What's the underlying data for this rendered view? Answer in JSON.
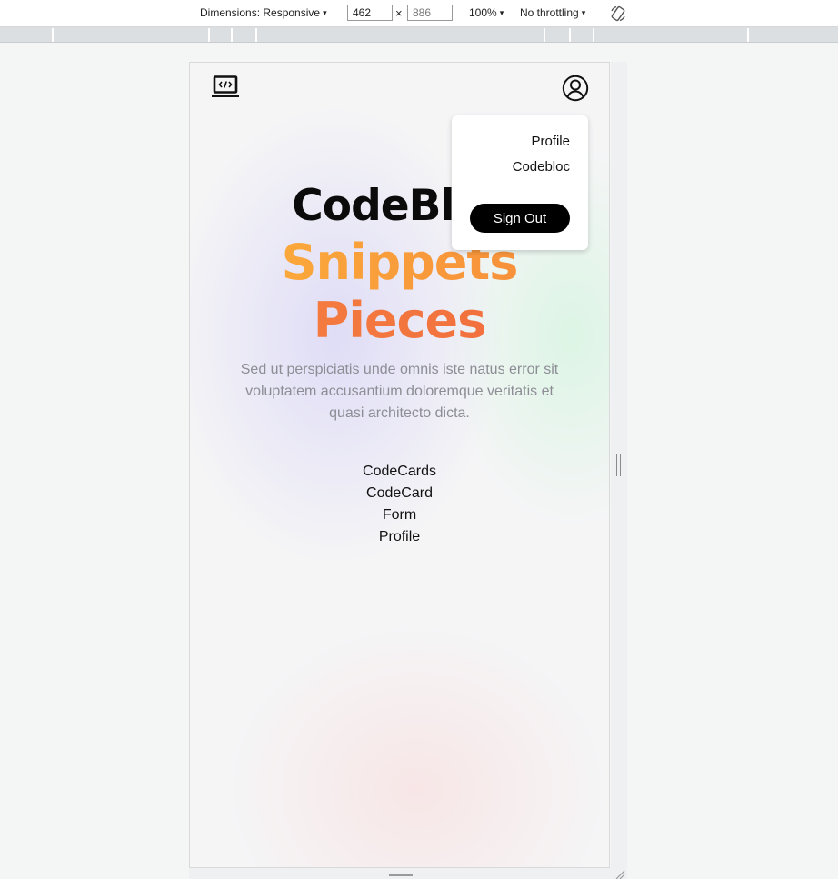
{
  "devtools": {
    "dimensions_label": "Dimensions: Responsive",
    "width_value": "462",
    "times_symbol": "×",
    "height_placeholder": "886",
    "zoom_label": "100%",
    "throttling_label": "No throttling",
    "caret": "▾"
  },
  "page": {
    "hero": {
      "line1": "CodeBloc",
      "line2": "Snippets",
      "line3": "Pieces",
      "description": "Sed ut perspiciatis unde omnis iste natus error sit voluptatem accusantium doloremque veritatis et quasi architecto dicta."
    },
    "nav_links": [
      "CodeCards",
      "CodeCard",
      "Form",
      "Profile"
    ],
    "dropdown": {
      "items": [
        "Profile",
        "Codebloc"
      ],
      "sign_out_label": "Sign Out"
    },
    "icons": {
      "logo": "laptop-code-icon",
      "account": "user-circle-icon"
    },
    "colors": {
      "gradient_start": "#fbb03b",
      "gradient_end": "#f06a3e",
      "description_text": "#8d8d95",
      "button_bg": "#000000"
    }
  }
}
